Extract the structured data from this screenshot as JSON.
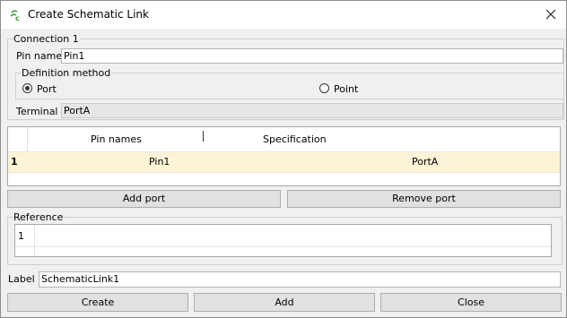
{
  "window": {
    "title": "Create Schematic Link",
    "close_icon": "close-icon",
    "app_icon": "schematic-link-icon"
  },
  "connection": {
    "legend": "Connection 1",
    "pin_name_label": "Pin name",
    "pin_name_value": "Pin1",
    "definition": {
      "legend": "Definition method",
      "options": [
        {
          "label": "Port",
          "selected": true
        },
        {
          "label": "Point",
          "selected": false
        }
      ]
    },
    "terminal_label": "Terminal",
    "terminal_value": "PortA"
  },
  "table": {
    "columns": [
      "Pin names",
      "Specification"
    ],
    "rows": [
      {
        "num": "1",
        "pin": "Pin1",
        "spec": "PortA"
      }
    ],
    "row_highlight": "#fdf3d6"
  },
  "buttons": {
    "add_port": "Add port",
    "remove_port": "Remove port"
  },
  "reference": {
    "legend": "Reference",
    "rows": [
      "1"
    ]
  },
  "label": {
    "caption": "Label",
    "value": "SchematicLink1"
  },
  "footer": {
    "create": "Create",
    "add": "Add",
    "close": "Close"
  }
}
